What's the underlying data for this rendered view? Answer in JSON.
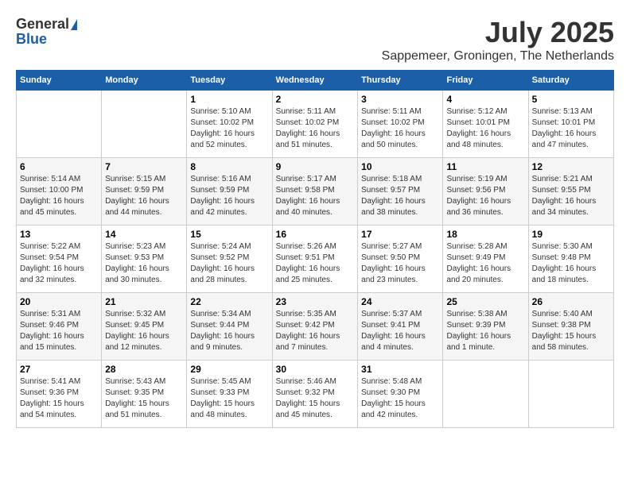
{
  "header": {
    "logo_general": "General",
    "logo_blue": "Blue",
    "month_year": "July 2025",
    "location": "Sappemeer, Groningen, The Netherlands"
  },
  "days_of_week": [
    "Sunday",
    "Monday",
    "Tuesday",
    "Wednesday",
    "Thursday",
    "Friday",
    "Saturday"
  ],
  "weeks": [
    [
      {
        "day": "",
        "sunrise": "",
        "sunset": "",
        "daylight": ""
      },
      {
        "day": "",
        "sunrise": "",
        "sunset": "",
        "daylight": ""
      },
      {
        "day": "1",
        "sunrise": "Sunrise: 5:10 AM",
        "sunset": "Sunset: 10:02 PM",
        "daylight": "Daylight: 16 hours and 52 minutes."
      },
      {
        "day": "2",
        "sunrise": "Sunrise: 5:11 AM",
        "sunset": "Sunset: 10:02 PM",
        "daylight": "Daylight: 16 hours and 51 minutes."
      },
      {
        "day": "3",
        "sunrise": "Sunrise: 5:11 AM",
        "sunset": "Sunset: 10:02 PM",
        "daylight": "Daylight: 16 hours and 50 minutes."
      },
      {
        "day": "4",
        "sunrise": "Sunrise: 5:12 AM",
        "sunset": "Sunset: 10:01 PM",
        "daylight": "Daylight: 16 hours and 48 minutes."
      },
      {
        "day": "5",
        "sunrise": "Sunrise: 5:13 AM",
        "sunset": "Sunset: 10:01 PM",
        "daylight": "Daylight: 16 hours and 47 minutes."
      }
    ],
    [
      {
        "day": "6",
        "sunrise": "Sunrise: 5:14 AM",
        "sunset": "Sunset: 10:00 PM",
        "daylight": "Daylight: 16 hours and 45 minutes."
      },
      {
        "day": "7",
        "sunrise": "Sunrise: 5:15 AM",
        "sunset": "Sunset: 9:59 PM",
        "daylight": "Daylight: 16 hours and 44 minutes."
      },
      {
        "day": "8",
        "sunrise": "Sunrise: 5:16 AM",
        "sunset": "Sunset: 9:59 PM",
        "daylight": "Daylight: 16 hours and 42 minutes."
      },
      {
        "day": "9",
        "sunrise": "Sunrise: 5:17 AM",
        "sunset": "Sunset: 9:58 PM",
        "daylight": "Daylight: 16 hours and 40 minutes."
      },
      {
        "day": "10",
        "sunrise": "Sunrise: 5:18 AM",
        "sunset": "Sunset: 9:57 PM",
        "daylight": "Daylight: 16 hours and 38 minutes."
      },
      {
        "day": "11",
        "sunrise": "Sunrise: 5:19 AM",
        "sunset": "Sunset: 9:56 PM",
        "daylight": "Daylight: 16 hours and 36 minutes."
      },
      {
        "day": "12",
        "sunrise": "Sunrise: 5:21 AM",
        "sunset": "Sunset: 9:55 PM",
        "daylight": "Daylight: 16 hours and 34 minutes."
      }
    ],
    [
      {
        "day": "13",
        "sunrise": "Sunrise: 5:22 AM",
        "sunset": "Sunset: 9:54 PM",
        "daylight": "Daylight: 16 hours and 32 minutes."
      },
      {
        "day": "14",
        "sunrise": "Sunrise: 5:23 AM",
        "sunset": "Sunset: 9:53 PM",
        "daylight": "Daylight: 16 hours and 30 minutes."
      },
      {
        "day": "15",
        "sunrise": "Sunrise: 5:24 AM",
        "sunset": "Sunset: 9:52 PM",
        "daylight": "Daylight: 16 hours and 28 minutes."
      },
      {
        "day": "16",
        "sunrise": "Sunrise: 5:26 AM",
        "sunset": "Sunset: 9:51 PM",
        "daylight": "Daylight: 16 hours and 25 minutes."
      },
      {
        "day": "17",
        "sunrise": "Sunrise: 5:27 AM",
        "sunset": "Sunset: 9:50 PM",
        "daylight": "Daylight: 16 hours and 23 minutes."
      },
      {
        "day": "18",
        "sunrise": "Sunrise: 5:28 AM",
        "sunset": "Sunset: 9:49 PM",
        "daylight": "Daylight: 16 hours and 20 minutes."
      },
      {
        "day": "19",
        "sunrise": "Sunrise: 5:30 AM",
        "sunset": "Sunset: 9:48 PM",
        "daylight": "Daylight: 16 hours and 18 minutes."
      }
    ],
    [
      {
        "day": "20",
        "sunrise": "Sunrise: 5:31 AM",
        "sunset": "Sunset: 9:46 PM",
        "daylight": "Daylight: 16 hours and 15 minutes."
      },
      {
        "day": "21",
        "sunrise": "Sunrise: 5:32 AM",
        "sunset": "Sunset: 9:45 PM",
        "daylight": "Daylight: 16 hours and 12 minutes."
      },
      {
        "day": "22",
        "sunrise": "Sunrise: 5:34 AM",
        "sunset": "Sunset: 9:44 PM",
        "daylight": "Daylight: 16 hours and 9 minutes."
      },
      {
        "day": "23",
        "sunrise": "Sunrise: 5:35 AM",
        "sunset": "Sunset: 9:42 PM",
        "daylight": "Daylight: 16 hours and 7 minutes."
      },
      {
        "day": "24",
        "sunrise": "Sunrise: 5:37 AM",
        "sunset": "Sunset: 9:41 PM",
        "daylight": "Daylight: 16 hours and 4 minutes."
      },
      {
        "day": "25",
        "sunrise": "Sunrise: 5:38 AM",
        "sunset": "Sunset: 9:39 PM",
        "daylight": "Daylight: 16 hours and 1 minute."
      },
      {
        "day": "26",
        "sunrise": "Sunrise: 5:40 AM",
        "sunset": "Sunset: 9:38 PM",
        "daylight": "Daylight: 15 hours and 58 minutes."
      }
    ],
    [
      {
        "day": "27",
        "sunrise": "Sunrise: 5:41 AM",
        "sunset": "Sunset: 9:36 PM",
        "daylight": "Daylight: 15 hours and 54 minutes."
      },
      {
        "day": "28",
        "sunrise": "Sunrise: 5:43 AM",
        "sunset": "Sunset: 9:35 PM",
        "daylight": "Daylight: 15 hours and 51 minutes."
      },
      {
        "day": "29",
        "sunrise": "Sunrise: 5:45 AM",
        "sunset": "Sunset: 9:33 PM",
        "daylight": "Daylight: 15 hours and 48 minutes."
      },
      {
        "day": "30",
        "sunrise": "Sunrise: 5:46 AM",
        "sunset": "Sunset: 9:32 PM",
        "daylight": "Daylight: 15 hours and 45 minutes."
      },
      {
        "day": "31",
        "sunrise": "Sunrise: 5:48 AM",
        "sunset": "Sunset: 9:30 PM",
        "daylight": "Daylight: 15 hours and 42 minutes."
      },
      {
        "day": "",
        "sunrise": "",
        "sunset": "",
        "daylight": ""
      },
      {
        "day": "",
        "sunrise": "",
        "sunset": "",
        "daylight": ""
      }
    ]
  ]
}
